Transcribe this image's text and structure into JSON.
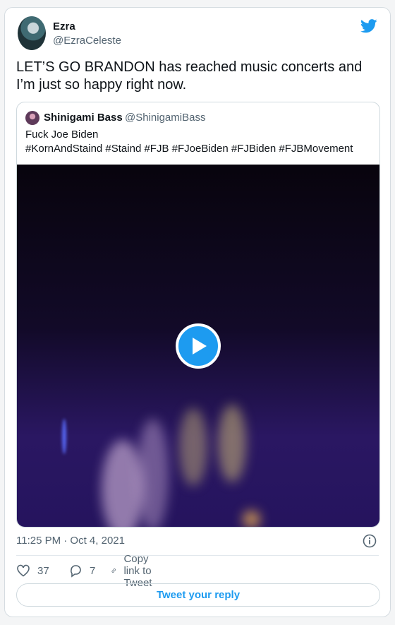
{
  "author": {
    "name": "Ezra",
    "handle": "@EzraCeleste"
  },
  "tweet": {
    "text": "LET’S GO BRANDON has reached music concerts and I’m just so happy right now."
  },
  "quote": {
    "name": "Shinigami Bass",
    "handle": "@ShinigamiBass",
    "line1": "Fuck Joe Biden",
    "line2": "#KornAndStaind #Staind #FJB #FJoeBiden #FJBiden #FJBMovement"
  },
  "meta": {
    "timestamp": "11:25 PM · Oct 4, 2021"
  },
  "actions": {
    "likes": "37",
    "replies": "7",
    "copy_link": "Copy link to Tweet"
  },
  "reply_button": "Tweet your reply",
  "colors": {
    "accent": "#1d9bf0",
    "text": "#0f1419",
    "muted": "#536471"
  },
  "icons": [
    "twitter-bird-icon",
    "play-icon",
    "info-icon",
    "heart-icon",
    "reply-icon",
    "link-icon"
  ]
}
